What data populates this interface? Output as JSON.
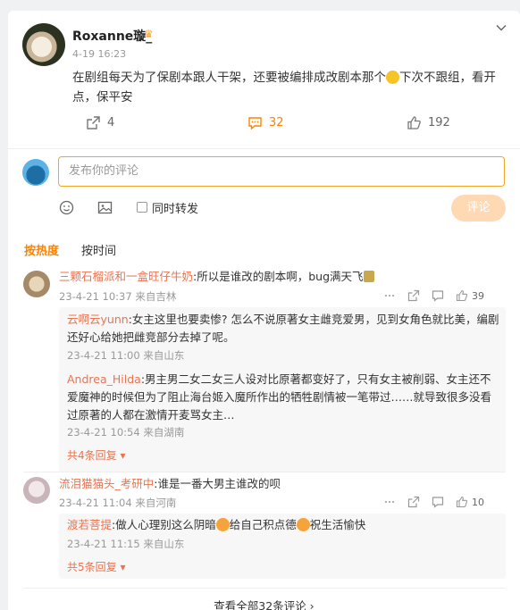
{
  "post": {
    "username": "Roxanne璇_",
    "time": "4-19 16:23",
    "text_part1": "在剧组每天为了保剧本跟人干架，还要被编排成改剧本那个",
    "text_part2": "下次不跟组，看开点，保平安",
    "repost_count": "4",
    "comment_count": "32",
    "like_count": "192"
  },
  "composer": {
    "placeholder": "发布你的评论",
    "repost_label": "同时转发",
    "submit_label": "评论"
  },
  "sort": {
    "hot": "按热度",
    "time": "按时间"
  },
  "comments": [
    {
      "name": "三颗石榴派和一盒旺仔牛奶",
      "text": ":所以是谁改的剧本啊，bug满天飞",
      "time": "23-4-21 10:37",
      "location": "来自吉林",
      "likes": "39",
      "replies": [
        {
          "name": "云啊云yunn",
          "text": ":女主这里也要卖惨? 怎么不说原著女主雌竞爱男，见到女角色就比美，编剧还好心给她把雌竞部分去掉了呢。",
          "time": "23-4-21 11:00",
          "location": "来自山东"
        },
        {
          "name": "Andrea_Hilda",
          "text": ":男主男二女二女三人设对比原著都变好了，只有女主被削弱、女主还不爱魔神的时候但为了阻止海台姬入魔所作出的牺牲剧情被一笔带过……就导致很多没看过原著的人都在激情开麦骂女主…",
          "time": "23-4-21 10:54",
          "location": "来自湖南"
        }
      ],
      "more_replies": "共4条回复"
    },
    {
      "name": "流泪猫猫头_考研中",
      "text": ":谁是一番大男主谁改的呗",
      "time": "23-4-21 11:04",
      "location": "来自河南",
      "likes": "10",
      "replies": [
        {
          "name": "渡若菩提",
          "text_part1": ":做人心理别这么阴暗",
          "text_part2": "给自己积点德",
          "text_part3": "祝生活愉快",
          "time": "23-4-21 11:15",
          "location": "来自山东"
        }
      ],
      "more_replies": "共5条回复"
    }
  ],
  "view_all": "查看全部32条评论 ›",
  "colors": {
    "accent": "#ff8200",
    "name": "#eb7350",
    "input_border": "#f5a623"
  }
}
